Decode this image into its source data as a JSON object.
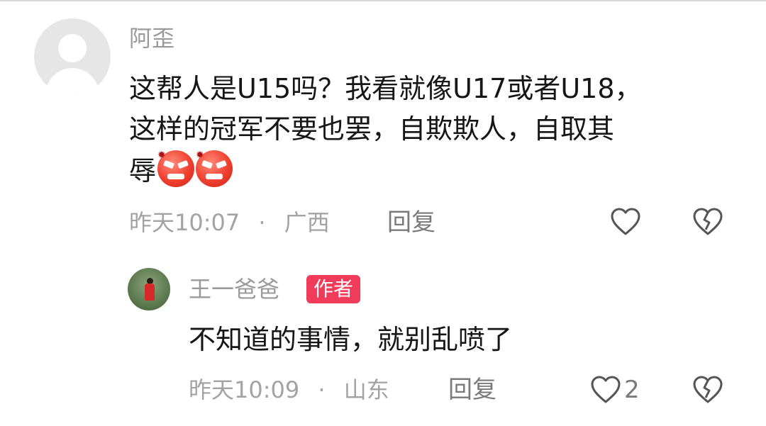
{
  "comment": {
    "username": "阿歪",
    "text_lines": [
      "这帮人是U15吗？我看就像U17或者U18，",
      "这样的冠军不要也罢，自欺欺人，自取其",
      "辱"
    ],
    "emojis": [
      "angry-face-icon",
      "angry-face-icon"
    ],
    "time": "昨天10:07",
    "separator": "·",
    "location": "广西",
    "reply_label": "回复",
    "like_icon": "heart-icon",
    "dislike_icon": "broken-heart-icon"
  },
  "reply": {
    "username": "王一爸爸",
    "badge": "作者",
    "text": "不知道的事情，就别乱喷了",
    "time": "昨天10:09",
    "separator": "·",
    "location": "山东",
    "reply_label": "回复",
    "like_count": "2",
    "like_icon": "heart-icon",
    "dislike_icon": "broken-heart-icon"
  },
  "colors": {
    "badge": "#f03c5a",
    "emoji": "#f0402f",
    "meta_text": "#a3a3a3"
  }
}
